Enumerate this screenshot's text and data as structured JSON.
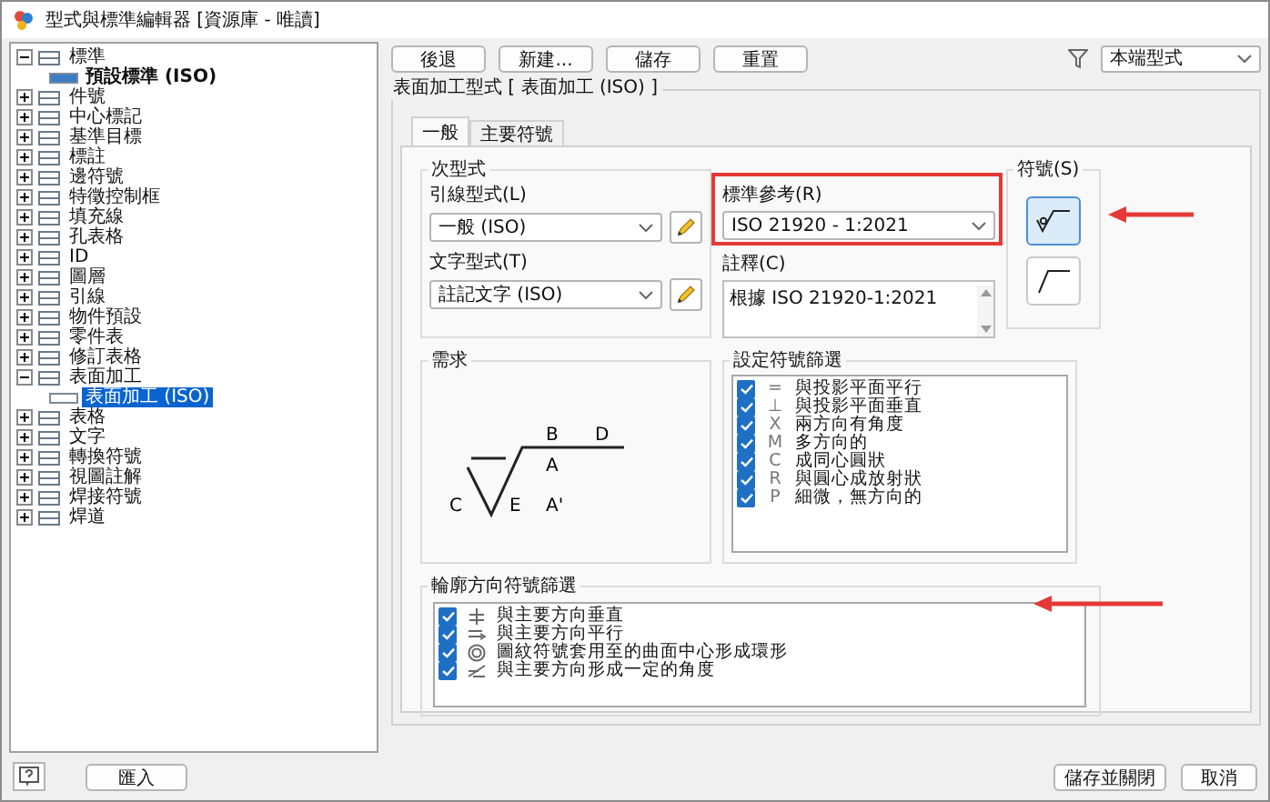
{
  "window": {
    "title": "型式與標準編輯器 [資源庫 - 唯讀]"
  },
  "tree": [
    {
      "label": "標準",
      "expanded": true,
      "children": [
        {
          "label": "預設標準 (ISO)",
          "bold": true,
          "selected": false
        }
      ]
    },
    {
      "label": "件號",
      "expanded": false
    },
    {
      "label": "中心標記",
      "expanded": false
    },
    {
      "label": "基準目標",
      "expanded": false
    },
    {
      "label": "標註",
      "expanded": false
    },
    {
      "label": "邊符號",
      "expanded": false
    },
    {
      "label": "特徵控制框",
      "expanded": false
    },
    {
      "label": "填充線",
      "expanded": false
    },
    {
      "label": "孔表格",
      "expanded": false
    },
    {
      "label": "ID",
      "expanded": false
    },
    {
      "label": "圖層",
      "expanded": false
    },
    {
      "label": "引線",
      "expanded": false
    },
    {
      "label": "物件預設",
      "expanded": false
    },
    {
      "label": "零件表",
      "expanded": false
    },
    {
      "label": "修訂表格",
      "expanded": false
    },
    {
      "label": "表面加工",
      "expanded": true,
      "children": [
        {
          "label": "表面加工 (ISO)",
          "bold": false,
          "selected": true
        }
      ]
    },
    {
      "label": "表格",
      "expanded": false
    },
    {
      "label": "文字",
      "expanded": false
    },
    {
      "label": "轉換符號",
      "expanded": false
    },
    {
      "label": "視圖註解",
      "expanded": false
    },
    {
      "label": "焊接符號",
      "expanded": false
    },
    {
      "label": "焊道",
      "expanded": false
    }
  ],
  "toolbar": [
    "後退",
    "新建...",
    "儲存",
    "重置"
  ],
  "filter": {
    "value": "本端型式"
  },
  "style_heading": "表面加工型式 [ 表面加工 (ISO) ]",
  "tabs": [
    {
      "label": "一般",
      "selected": true
    },
    {
      "label": "主要符號",
      "selected": false
    }
  ],
  "sub_styles": {
    "title": "次型式",
    "fields": [
      {
        "label": "引線型式(L)",
        "value": "一般 (ISO)"
      },
      {
        "label": "文字型式(T)",
        "value": "註記文字 (ISO)"
      }
    ]
  },
  "standard_reference": {
    "label": "標準參考(R)",
    "value": "ISO 21920 - 1:2021"
  },
  "comment": {
    "label": "註釋(C)",
    "value": "根據 ISO 21920-1:2021"
  },
  "symbol": {
    "label": "符號(S)",
    "options": [
      {
        "kind": "check",
        "selected": true
      },
      {
        "kind": "ramp",
        "selected": false
      }
    ]
  },
  "requirements": {
    "title": "需求",
    "letters": {
      "b": "B",
      "d": "D",
      "a": "A",
      "c": "C",
      "e": "E",
      "a2": "A'"
    }
  },
  "lay_filter": {
    "title": "設定符號篩選",
    "items": [
      {
        "symbol": "=",
        "label": "與投影平面平行",
        "checked": true
      },
      {
        "symbol": "⊥",
        "label": "與投影平面垂直",
        "checked": true
      },
      {
        "symbol": "X",
        "label": "兩方向有角度",
        "checked": true
      },
      {
        "symbol": "M",
        "label": "多方向的",
        "checked": true
      },
      {
        "symbol": "C",
        "label": "成同心圓狀",
        "checked": true
      },
      {
        "symbol": "R",
        "label": "與圓心成放射狀",
        "checked": true
      },
      {
        "symbol": "P",
        "label": "細微，無方向的",
        "checked": true
      }
    ]
  },
  "profile_filter": {
    "title": "輪廓方向符號篩選",
    "items": [
      {
        "kind": "perpendicular",
        "label": "與主要方向垂直",
        "checked": true
      },
      {
        "kind": "parallel",
        "label": "與主要方向平行",
        "checked": true
      },
      {
        "kind": "circular",
        "label": "圖紋符號套用至的曲面中心形成環形",
        "checked": true
      },
      {
        "kind": "angle",
        "label": "與主要方向形成一定的角度",
        "checked": true
      }
    ]
  },
  "footer": {
    "import": "匯入",
    "save_close": "儲存並關閉",
    "cancel": "取消"
  }
}
